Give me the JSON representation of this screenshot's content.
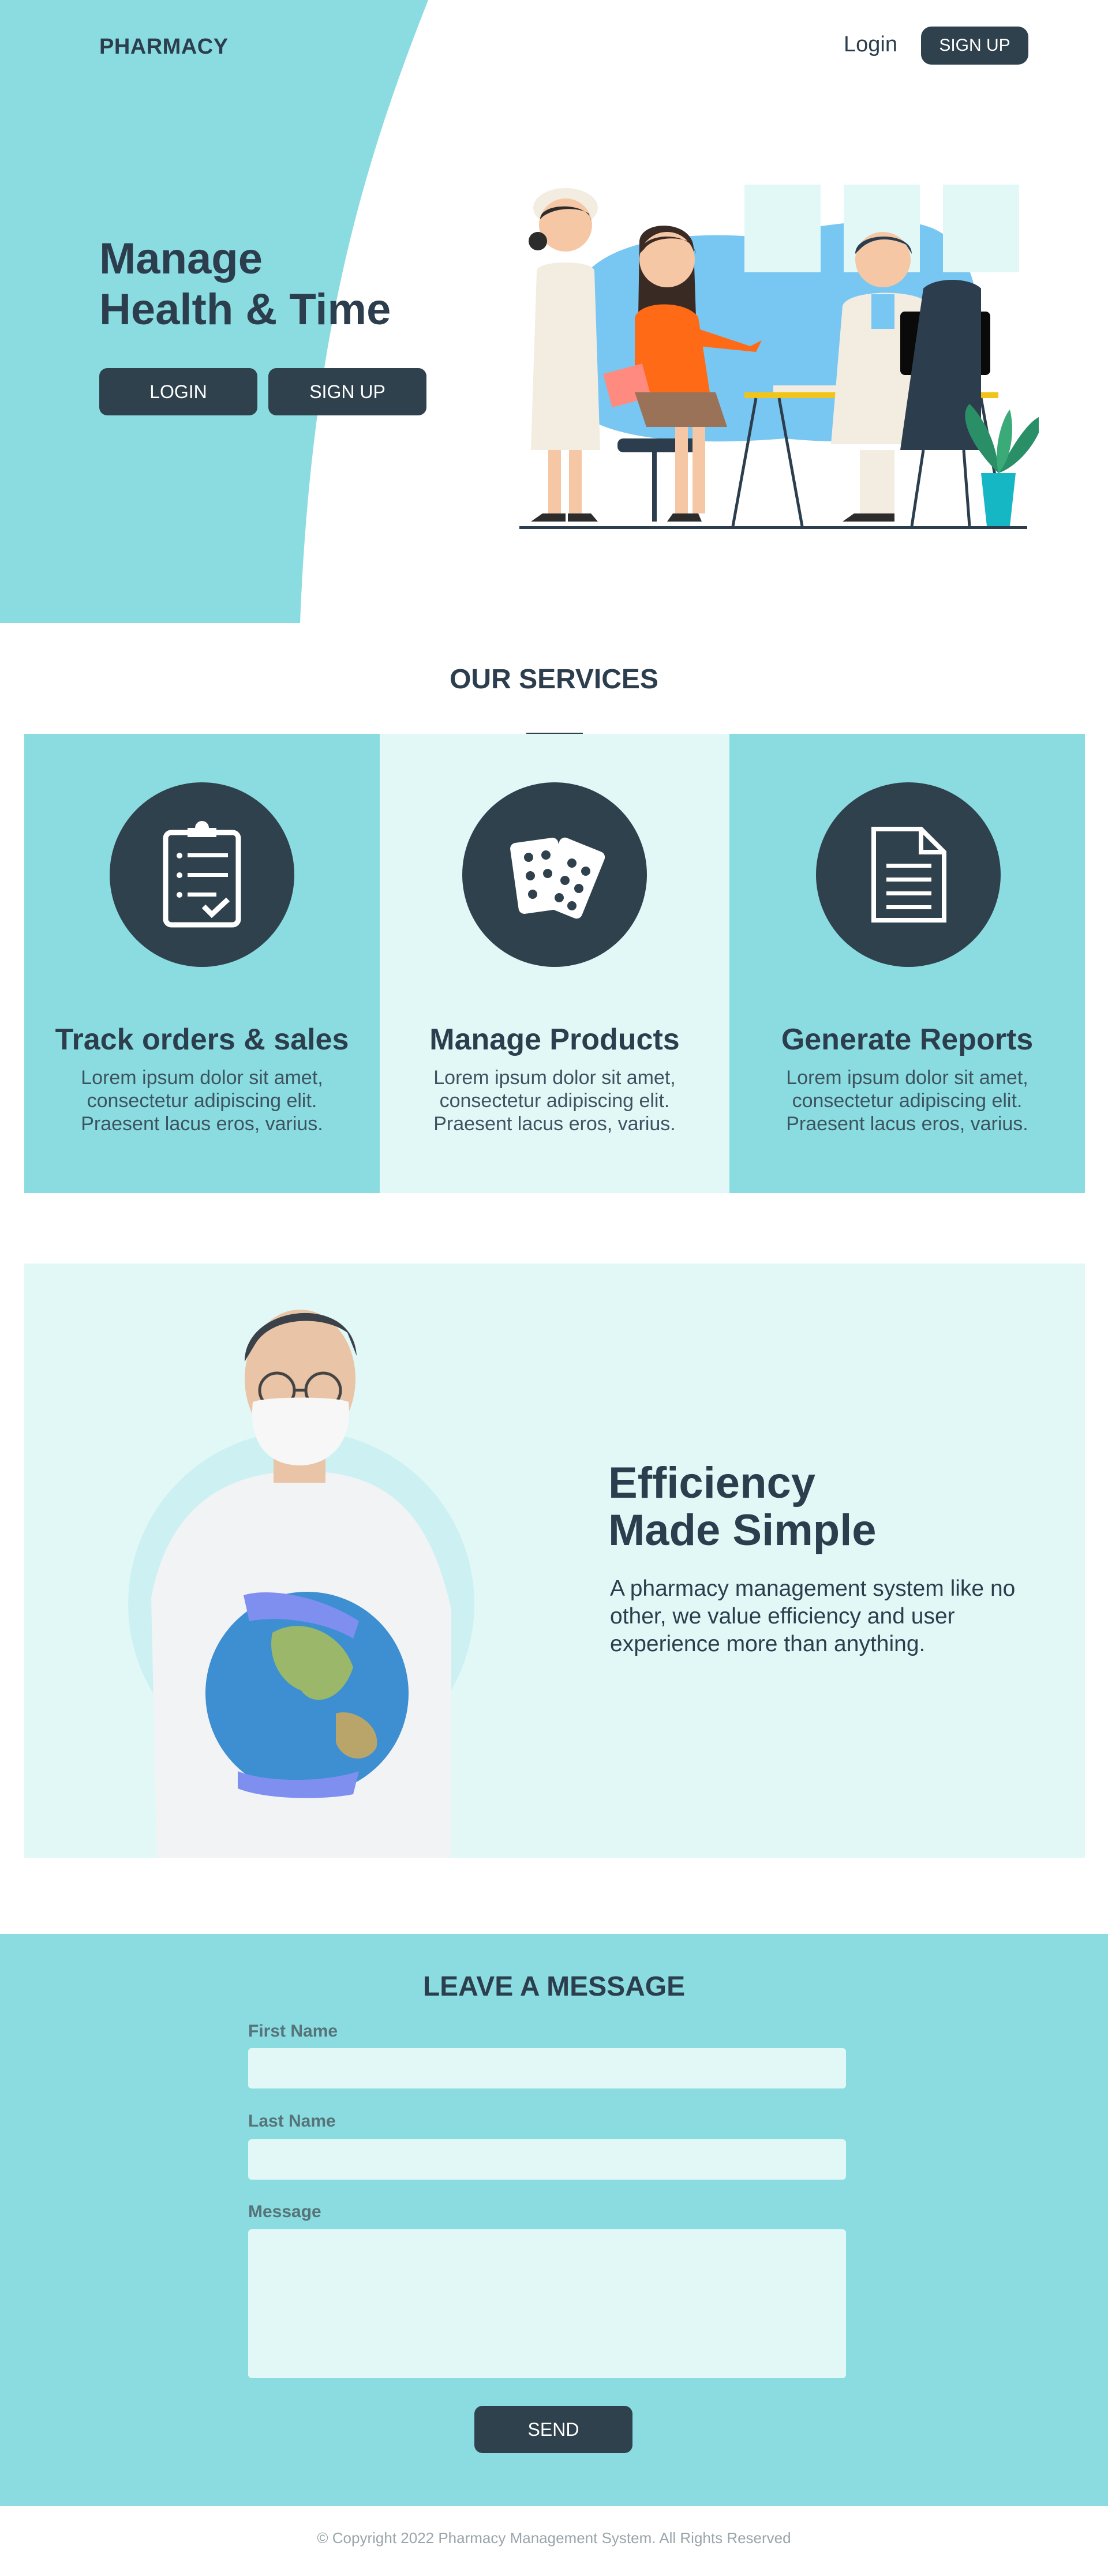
{
  "header": {
    "brand": "PHARMACY",
    "login_label": "Login",
    "signup_label": "SIGN UP"
  },
  "hero": {
    "title_line1": "Manage",
    "title_line2": "Health & Time",
    "login_button": "LOGIN",
    "signup_button": "SIGN UP"
  },
  "services": {
    "title": "OUR SERVICES",
    "items": [
      {
        "title": "Track orders & sales",
        "desc": "Lorem ipsum dolor sit amet, consectetur adipiscing elit. Praesent lacus eros, varius.",
        "icon": "clipboard-icon"
      },
      {
        "title": "Manage Products",
        "desc": "Lorem ipsum dolor sit amet, consectetur adipiscing elit. Praesent lacus eros, varius.",
        "icon": "pills-icon"
      },
      {
        "title": "Generate Reports",
        "desc": "Lorem ipsum dolor sit amet, consectetur adipiscing elit. Praesent lacus eros, varius.",
        "icon": "document-icon"
      }
    ]
  },
  "efficiency": {
    "title_line1": "Efficiency",
    "title_line2": "Made Simple",
    "desc": "A pharmacy management system like no other, we value efficiency and user experience more than anything."
  },
  "contact": {
    "title": "LEAVE A MESSAGE",
    "first_name_label": "First Name",
    "last_name_label": "Last Name",
    "message_label": "Message",
    "first_name_value": "",
    "last_name_value": "",
    "message_value": "",
    "send_label": "SEND"
  },
  "footer": {
    "copyright": "© Copyright 2022 Pharmacy Management System. All Rights Reserved"
  },
  "colors": {
    "teal": "#8adce0",
    "light_teal": "#e2f8f7",
    "dark": "#2f414d",
    "text": "#2c3e4d"
  }
}
